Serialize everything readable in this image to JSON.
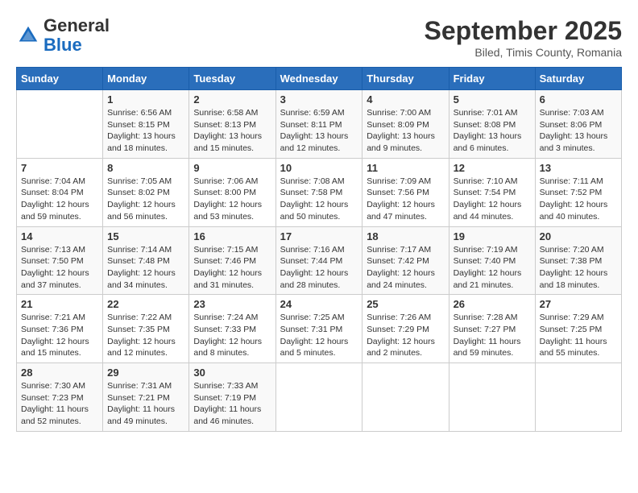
{
  "header": {
    "logo_general": "General",
    "logo_blue": "Blue",
    "month_title": "September 2025",
    "subtitle": "Biled, Timis County, Romania"
  },
  "weekdays": [
    "Sunday",
    "Monday",
    "Tuesday",
    "Wednesday",
    "Thursday",
    "Friday",
    "Saturday"
  ],
  "weeks": [
    [
      {
        "day": "",
        "info": ""
      },
      {
        "day": "1",
        "info": "Sunrise: 6:56 AM\nSunset: 8:15 PM\nDaylight: 13 hours\nand 18 minutes."
      },
      {
        "day": "2",
        "info": "Sunrise: 6:58 AM\nSunset: 8:13 PM\nDaylight: 13 hours\nand 15 minutes."
      },
      {
        "day": "3",
        "info": "Sunrise: 6:59 AM\nSunset: 8:11 PM\nDaylight: 13 hours\nand 12 minutes."
      },
      {
        "day": "4",
        "info": "Sunrise: 7:00 AM\nSunset: 8:09 PM\nDaylight: 13 hours\nand 9 minutes."
      },
      {
        "day": "5",
        "info": "Sunrise: 7:01 AM\nSunset: 8:08 PM\nDaylight: 13 hours\nand 6 minutes."
      },
      {
        "day": "6",
        "info": "Sunrise: 7:03 AM\nSunset: 8:06 PM\nDaylight: 13 hours\nand 3 minutes."
      }
    ],
    [
      {
        "day": "7",
        "info": "Sunrise: 7:04 AM\nSunset: 8:04 PM\nDaylight: 12 hours\nand 59 minutes."
      },
      {
        "day": "8",
        "info": "Sunrise: 7:05 AM\nSunset: 8:02 PM\nDaylight: 12 hours\nand 56 minutes."
      },
      {
        "day": "9",
        "info": "Sunrise: 7:06 AM\nSunset: 8:00 PM\nDaylight: 12 hours\nand 53 minutes."
      },
      {
        "day": "10",
        "info": "Sunrise: 7:08 AM\nSunset: 7:58 PM\nDaylight: 12 hours\nand 50 minutes."
      },
      {
        "day": "11",
        "info": "Sunrise: 7:09 AM\nSunset: 7:56 PM\nDaylight: 12 hours\nand 47 minutes."
      },
      {
        "day": "12",
        "info": "Sunrise: 7:10 AM\nSunset: 7:54 PM\nDaylight: 12 hours\nand 44 minutes."
      },
      {
        "day": "13",
        "info": "Sunrise: 7:11 AM\nSunset: 7:52 PM\nDaylight: 12 hours\nand 40 minutes."
      }
    ],
    [
      {
        "day": "14",
        "info": "Sunrise: 7:13 AM\nSunset: 7:50 PM\nDaylight: 12 hours\nand 37 minutes."
      },
      {
        "day": "15",
        "info": "Sunrise: 7:14 AM\nSunset: 7:48 PM\nDaylight: 12 hours\nand 34 minutes."
      },
      {
        "day": "16",
        "info": "Sunrise: 7:15 AM\nSunset: 7:46 PM\nDaylight: 12 hours\nand 31 minutes."
      },
      {
        "day": "17",
        "info": "Sunrise: 7:16 AM\nSunset: 7:44 PM\nDaylight: 12 hours\nand 28 minutes."
      },
      {
        "day": "18",
        "info": "Sunrise: 7:17 AM\nSunset: 7:42 PM\nDaylight: 12 hours\nand 24 minutes."
      },
      {
        "day": "19",
        "info": "Sunrise: 7:19 AM\nSunset: 7:40 PM\nDaylight: 12 hours\nand 21 minutes."
      },
      {
        "day": "20",
        "info": "Sunrise: 7:20 AM\nSunset: 7:38 PM\nDaylight: 12 hours\nand 18 minutes."
      }
    ],
    [
      {
        "day": "21",
        "info": "Sunrise: 7:21 AM\nSunset: 7:36 PM\nDaylight: 12 hours\nand 15 minutes."
      },
      {
        "day": "22",
        "info": "Sunrise: 7:22 AM\nSunset: 7:35 PM\nDaylight: 12 hours\nand 12 minutes."
      },
      {
        "day": "23",
        "info": "Sunrise: 7:24 AM\nSunset: 7:33 PM\nDaylight: 12 hours\nand 8 minutes."
      },
      {
        "day": "24",
        "info": "Sunrise: 7:25 AM\nSunset: 7:31 PM\nDaylight: 12 hours\nand 5 minutes."
      },
      {
        "day": "25",
        "info": "Sunrise: 7:26 AM\nSunset: 7:29 PM\nDaylight: 12 hours\nand 2 minutes."
      },
      {
        "day": "26",
        "info": "Sunrise: 7:28 AM\nSunset: 7:27 PM\nDaylight: 11 hours\nand 59 minutes."
      },
      {
        "day": "27",
        "info": "Sunrise: 7:29 AM\nSunset: 7:25 PM\nDaylight: 11 hours\nand 55 minutes."
      }
    ],
    [
      {
        "day": "28",
        "info": "Sunrise: 7:30 AM\nSunset: 7:23 PM\nDaylight: 11 hours\nand 52 minutes."
      },
      {
        "day": "29",
        "info": "Sunrise: 7:31 AM\nSunset: 7:21 PM\nDaylight: 11 hours\nand 49 minutes."
      },
      {
        "day": "30",
        "info": "Sunrise: 7:33 AM\nSunset: 7:19 PM\nDaylight: 11 hours\nand 46 minutes."
      },
      {
        "day": "",
        "info": ""
      },
      {
        "day": "",
        "info": ""
      },
      {
        "day": "",
        "info": ""
      },
      {
        "day": "",
        "info": ""
      }
    ]
  ]
}
